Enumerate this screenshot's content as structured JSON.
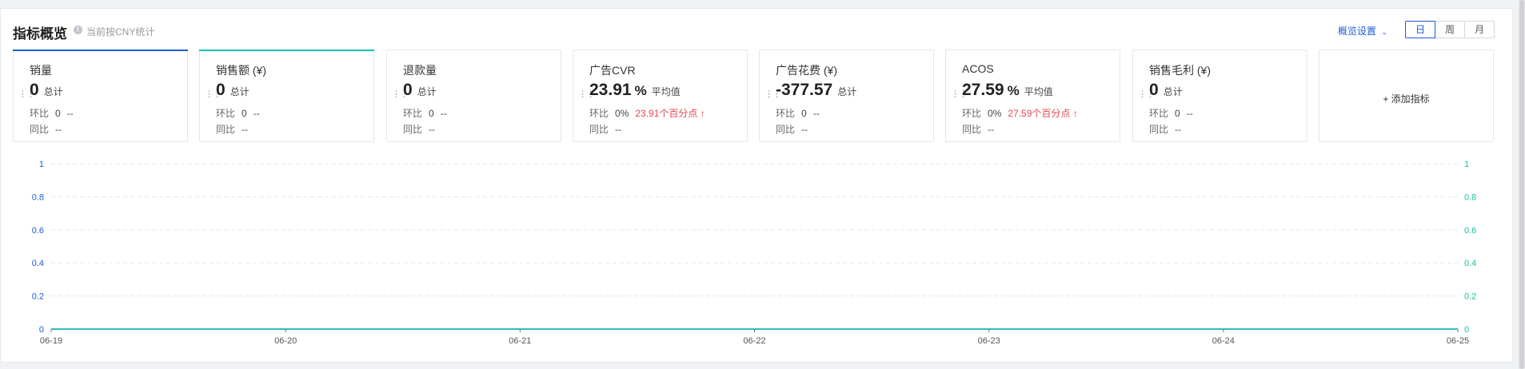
{
  "header": {
    "title": "指标概览",
    "hint_icon": "info-icon",
    "hint": "当前按CNY统计",
    "settings_label": "概览设置",
    "settings_icon": "chevron-down-icon",
    "periods": [
      "日",
      "周",
      "月"
    ],
    "active_period": "日"
  },
  "colors": {
    "blue": "#1d5bd6",
    "teal": "#14c3a6",
    "red": "#e5484d"
  },
  "cards": [
    {
      "name": "销量",
      "value": "0",
      "unit": "",
      "value_label": "总计",
      "mom_label": "环比",
      "mom_value": "0",
      "mom_delta": "--",
      "yoy_label": "同比",
      "yoy_value": "--",
      "accent": "blue"
    },
    {
      "name": "销售额 (¥)",
      "value": "0",
      "unit": "",
      "value_label": "总计",
      "mom_label": "环比",
      "mom_value": "0",
      "mom_delta": "--",
      "yoy_label": "同比",
      "yoy_value": "--",
      "accent": "teal"
    },
    {
      "name": "退款量",
      "value": "0",
      "unit": "",
      "value_label": "总计",
      "mom_label": "环比",
      "mom_value": "0",
      "mom_delta": "--",
      "yoy_label": "同比",
      "yoy_value": "--",
      "accent": ""
    },
    {
      "name": "广告CVR",
      "value": "23.91",
      "unit": "%",
      "value_label": "平均值",
      "mom_label": "环比",
      "mom_value": "0%",
      "mom_delta": "23.91个百分点 ↑",
      "mom_delta_color": "red",
      "yoy_label": "同比",
      "yoy_value": "--",
      "accent": ""
    },
    {
      "name": "广告花费 (¥)",
      "value": "-377.57",
      "unit": "",
      "value_label": "总计",
      "mom_label": "环比",
      "mom_value": "0",
      "mom_delta": "--",
      "yoy_label": "同比",
      "yoy_value": "--",
      "accent": ""
    },
    {
      "name": "ACOS",
      "value": "27.59",
      "unit": "%",
      "value_label": "平均值",
      "mom_label": "环比",
      "mom_value": "0%",
      "mom_delta": "27.59个百分点 ↑",
      "mom_delta_color": "red",
      "yoy_label": "同比",
      "yoy_value": "--",
      "accent": ""
    },
    {
      "name": "销售毛利 (¥)",
      "value": "0",
      "unit": "",
      "value_label": "总计",
      "mom_label": "环比",
      "mom_value": "0",
      "mom_delta": "--",
      "yoy_label": "同比",
      "yoy_value": "--",
      "accent": ""
    }
  ],
  "add_metric_label": "+ 添加指标",
  "chart_data": {
    "type": "line",
    "x": [
      "06-19",
      "06-20",
      "06-21",
      "06-22",
      "06-23",
      "06-24",
      "06-25"
    ],
    "yticks_left": [
      "0",
      "0.2",
      "0.4",
      "0.6",
      "0.8",
      "1"
    ],
    "yticks_right": [
      "0",
      "0.2",
      "0.4",
      "0.6",
      "0.8",
      "1"
    ],
    "ylim": [
      0,
      1
    ],
    "grid": true,
    "series": [
      {
        "values": [
          0,
          0,
          0,
          0,
          0,
          0,
          0
        ],
        "color": "#1d5bd6",
        "axis": "left"
      },
      {
        "values": [
          0,
          0,
          0,
          0,
          0,
          0,
          0
        ],
        "color": "#14c3a6",
        "axis": "right"
      }
    ]
  }
}
